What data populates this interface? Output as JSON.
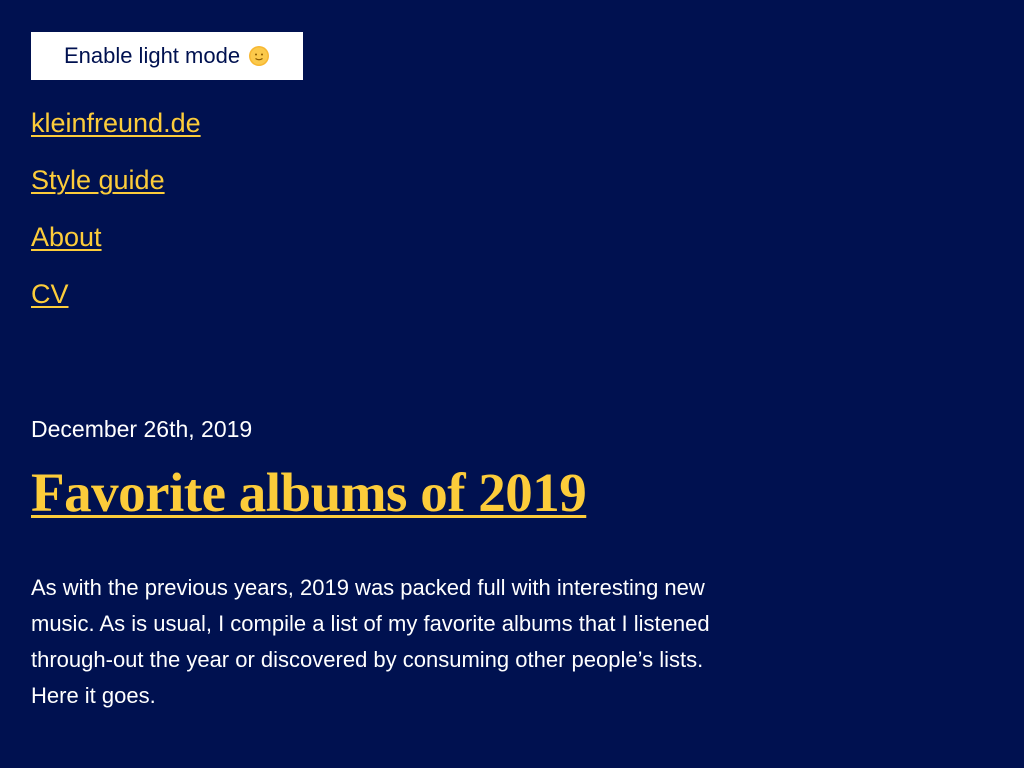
{
  "toggle": {
    "label": "Enable light mode",
    "icon": "sun-face-icon"
  },
  "nav": {
    "items": [
      {
        "label": "kleinfreund.de"
      },
      {
        "label": "Style guide"
      },
      {
        "label": "About"
      },
      {
        "label": "CV"
      }
    ]
  },
  "post": {
    "date": "December 26th, 2019",
    "title": "Favorite albums of 2019",
    "intro": "As with the previous years, 2019 was packed full with interesting new music. As is usual, I compile a list of my favorite albums that I listened through-out the year or discovered by consuming other people’s lists. Here it goes."
  },
  "colors": {
    "background": "#001150",
    "link": "#fccc3a",
    "text": "#ffffff"
  }
}
